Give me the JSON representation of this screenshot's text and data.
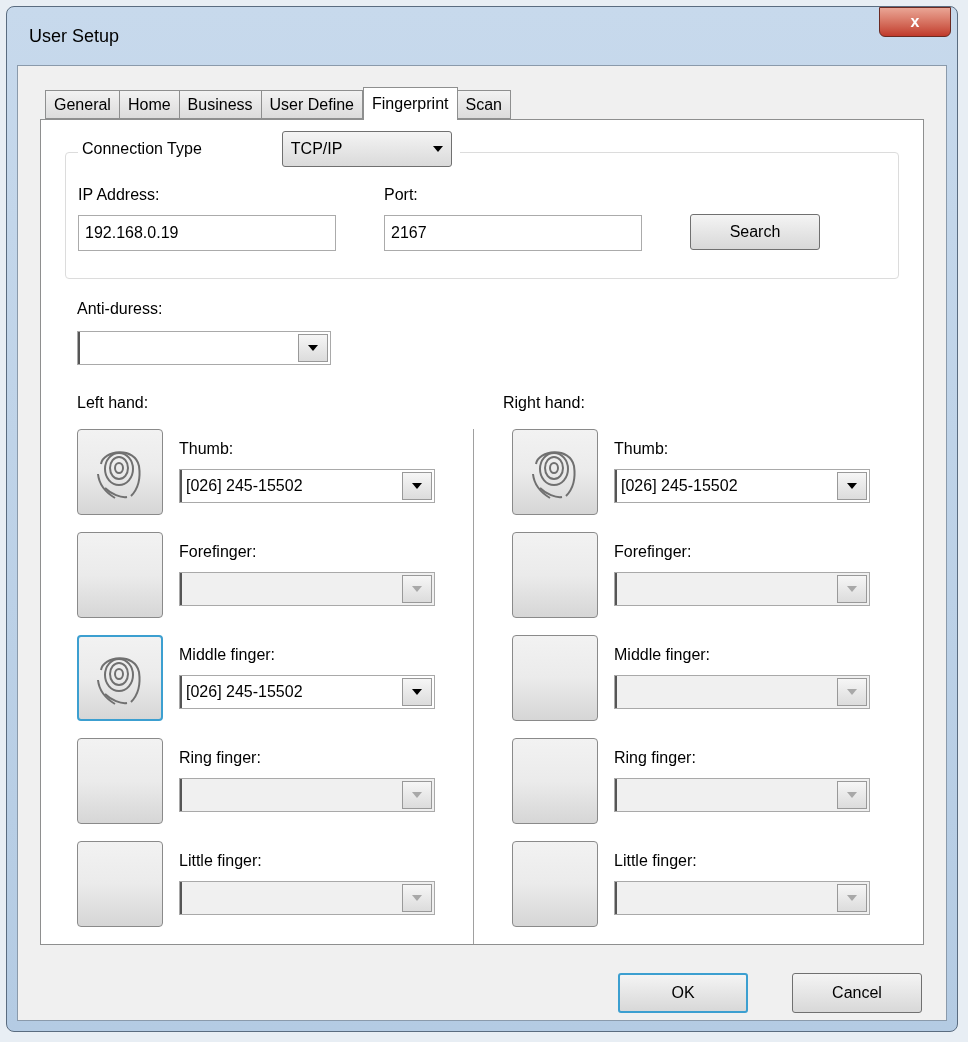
{
  "window": {
    "title": "User Setup",
    "close_label": "x"
  },
  "tabs": [
    {
      "label": "General",
      "selected": false
    },
    {
      "label": "Home",
      "selected": false
    },
    {
      "label": "Business",
      "selected": false
    },
    {
      "label": "User Define",
      "selected": false
    },
    {
      "label": "Fingerprint",
      "selected": true
    },
    {
      "label": "Scan",
      "selected": false
    }
  ],
  "connection": {
    "legend": "Connection Type",
    "type_value": "TCP/IP",
    "ip_label": "IP Address:",
    "ip_value": "192.168.0.19",
    "port_label": "Port:",
    "port_value": "2167",
    "search_button": "Search"
  },
  "anti_duress": {
    "label": "Anti-duress:"
  },
  "hands": [
    {
      "label": "Left hand:",
      "fingers": [
        {
          "label": "Thumb:",
          "enrolled": true,
          "focused": false,
          "disabled": false,
          "value": "[026] 245-15502"
        },
        {
          "label": "Forefinger:",
          "enrolled": false,
          "focused": false,
          "disabled": true
        },
        {
          "label": "Middle finger:",
          "enrolled": true,
          "focused": true,
          "disabled": false,
          "value": "[026] 245-15502"
        },
        {
          "label": "Ring finger:",
          "enrolled": false,
          "focused": false,
          "disabled": true
        },
        {
          "label": "Little finger:",
          "enrolled": false,
          "focused": false,
          "disabled": true
        }
      ]
    },
    {
      "label": "Right hand:",
      "fingers": [
        {
          "label": "Thumb:",
          "enrolled": true,
          "focused": false,
          "disabled": false,
          "value": "[026] 245-15502"
        },
        {
          "label": "Forefinger:",
          "enrolled": false,
          "focused": false,
          "disabled": true
        },
        {
          "label": "Middle finger:",
          "enrolled": false,
          "focused": false,
          "disabled": true
        },
        {
          "label": "Ring finger:",
          "enrolled": false,
          "focused": false,
          "disabled": true
        },
        {
          "label": "Little finger:",
          "enrolled": false,
          "focused": false,
          "disabled": true
        }
      ]
    }
  ],
  "buttons": [
    {
      "label": "OK",
      "default": true
    },
    {
      "label": "Cancel",
      "default": false
    }
  ]
}
